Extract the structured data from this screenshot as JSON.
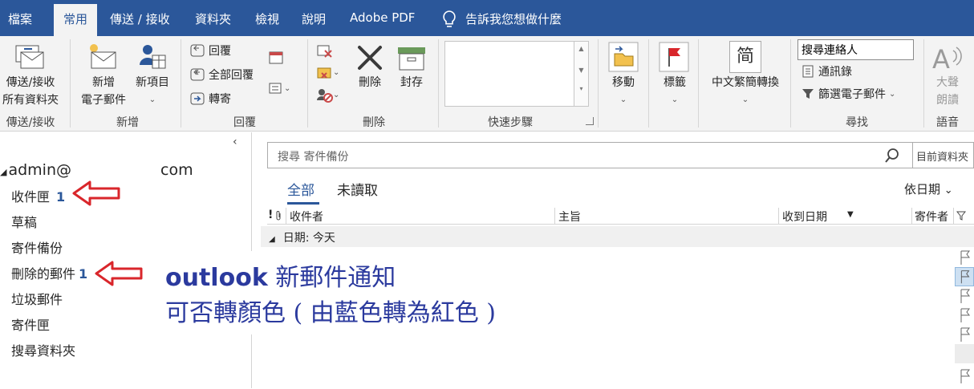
{
  "menu": {
    "tabs": [
      "檔案",
      "常用",
      "傳送 / 接收",
      "資料夾",
      "檢視",
      "說明",
      "Adobe PDF"
    ],
    "active_tab": "常用",
    "tell_me": "告訴我您想做什麼",
    "accent_color": "#2b579a"
  },
  "ribbon": {
    "send_receive": {
      "line1": "傳送/接收",
      "line2": "所有資料夾",
      "group": "傳送/接收"
    },
    "new": {
      "new_email_line1": "新增",
      "new_email_line2": "電子郵件",
      "new_items": "新項目",
      "group": "新增"
    },
    "respond": {
      "reply": "回覆",
      "reply_all": "全部回覆",
      "forward": "轉寄",
      "group": "回覆"
    },
    "delete": {
      "delete": "刪除",
      "archive": "封存",
      "group": "刪除"
    },
    "quick_steps": {
      "group": "快速步驟"
    },
    "move": {
      "label": "移動"
    },
    "tags": {
      "label": "標籤"
    },
    "chinese_conv": {
      "icon_text": "简",
      "label": "中文繁簡轉換"
    },
    "find": {
      "search_people": "搜尋連絡人",
      "address_book": "通訊錄",
      "filter_email": "篩選電子郵件",
      "group": "尋找"
    },
    "speech": {
      "read_aloud_1": "大聲",
      "read_aloud_2": "朗讀",
      "group": "語音"
    }
  },
  "folder_pane": {
    "account_prefix": "admin@",
    "account_suffix": "com",
    "folders": [
      {
        "name": "收件匣",
        "count": "1"
      },
      {
        "name": "草稿",
        "count": ""
      },
      {
        "name": "寄件備份",
        "count": ""
      },
      {
        "name": "刪除的郵件",
        "count": "1"
      },
      {
        "name": "垃圾郵件",
        "count": ""
      },
      {
        "name": "寄件匣",
        "count": ""
      },
      {
        "name": "搜尋資料夾",
        "count": ""
      }
    ]
  },
  "message_list": {
    "search_placeholder": "搜尋 寄件備份",
    "search_scope": "目前資料夾",
    "filter_all": "全部",
    "filter_unread": "未讀取",
    "sort_by": "依日期",
    "columns": {
      "icons": "!",
      "recipient": "收件者",
      "subject": "主旨",
      "received": "收到日期",
      "sender": "寄件者"
    },
    "group_header": "日期: 今天"
  },
  "annotation": {
    "line1_en": "outlook",
    "line1_zh": " 新郵件通知",
    "line2": "可否轉顏色 ( 由藍色轉為紅色 )",
    "text_color": "#2b3a9e",
    "arrow_color": "#d9262b"
  }
}
